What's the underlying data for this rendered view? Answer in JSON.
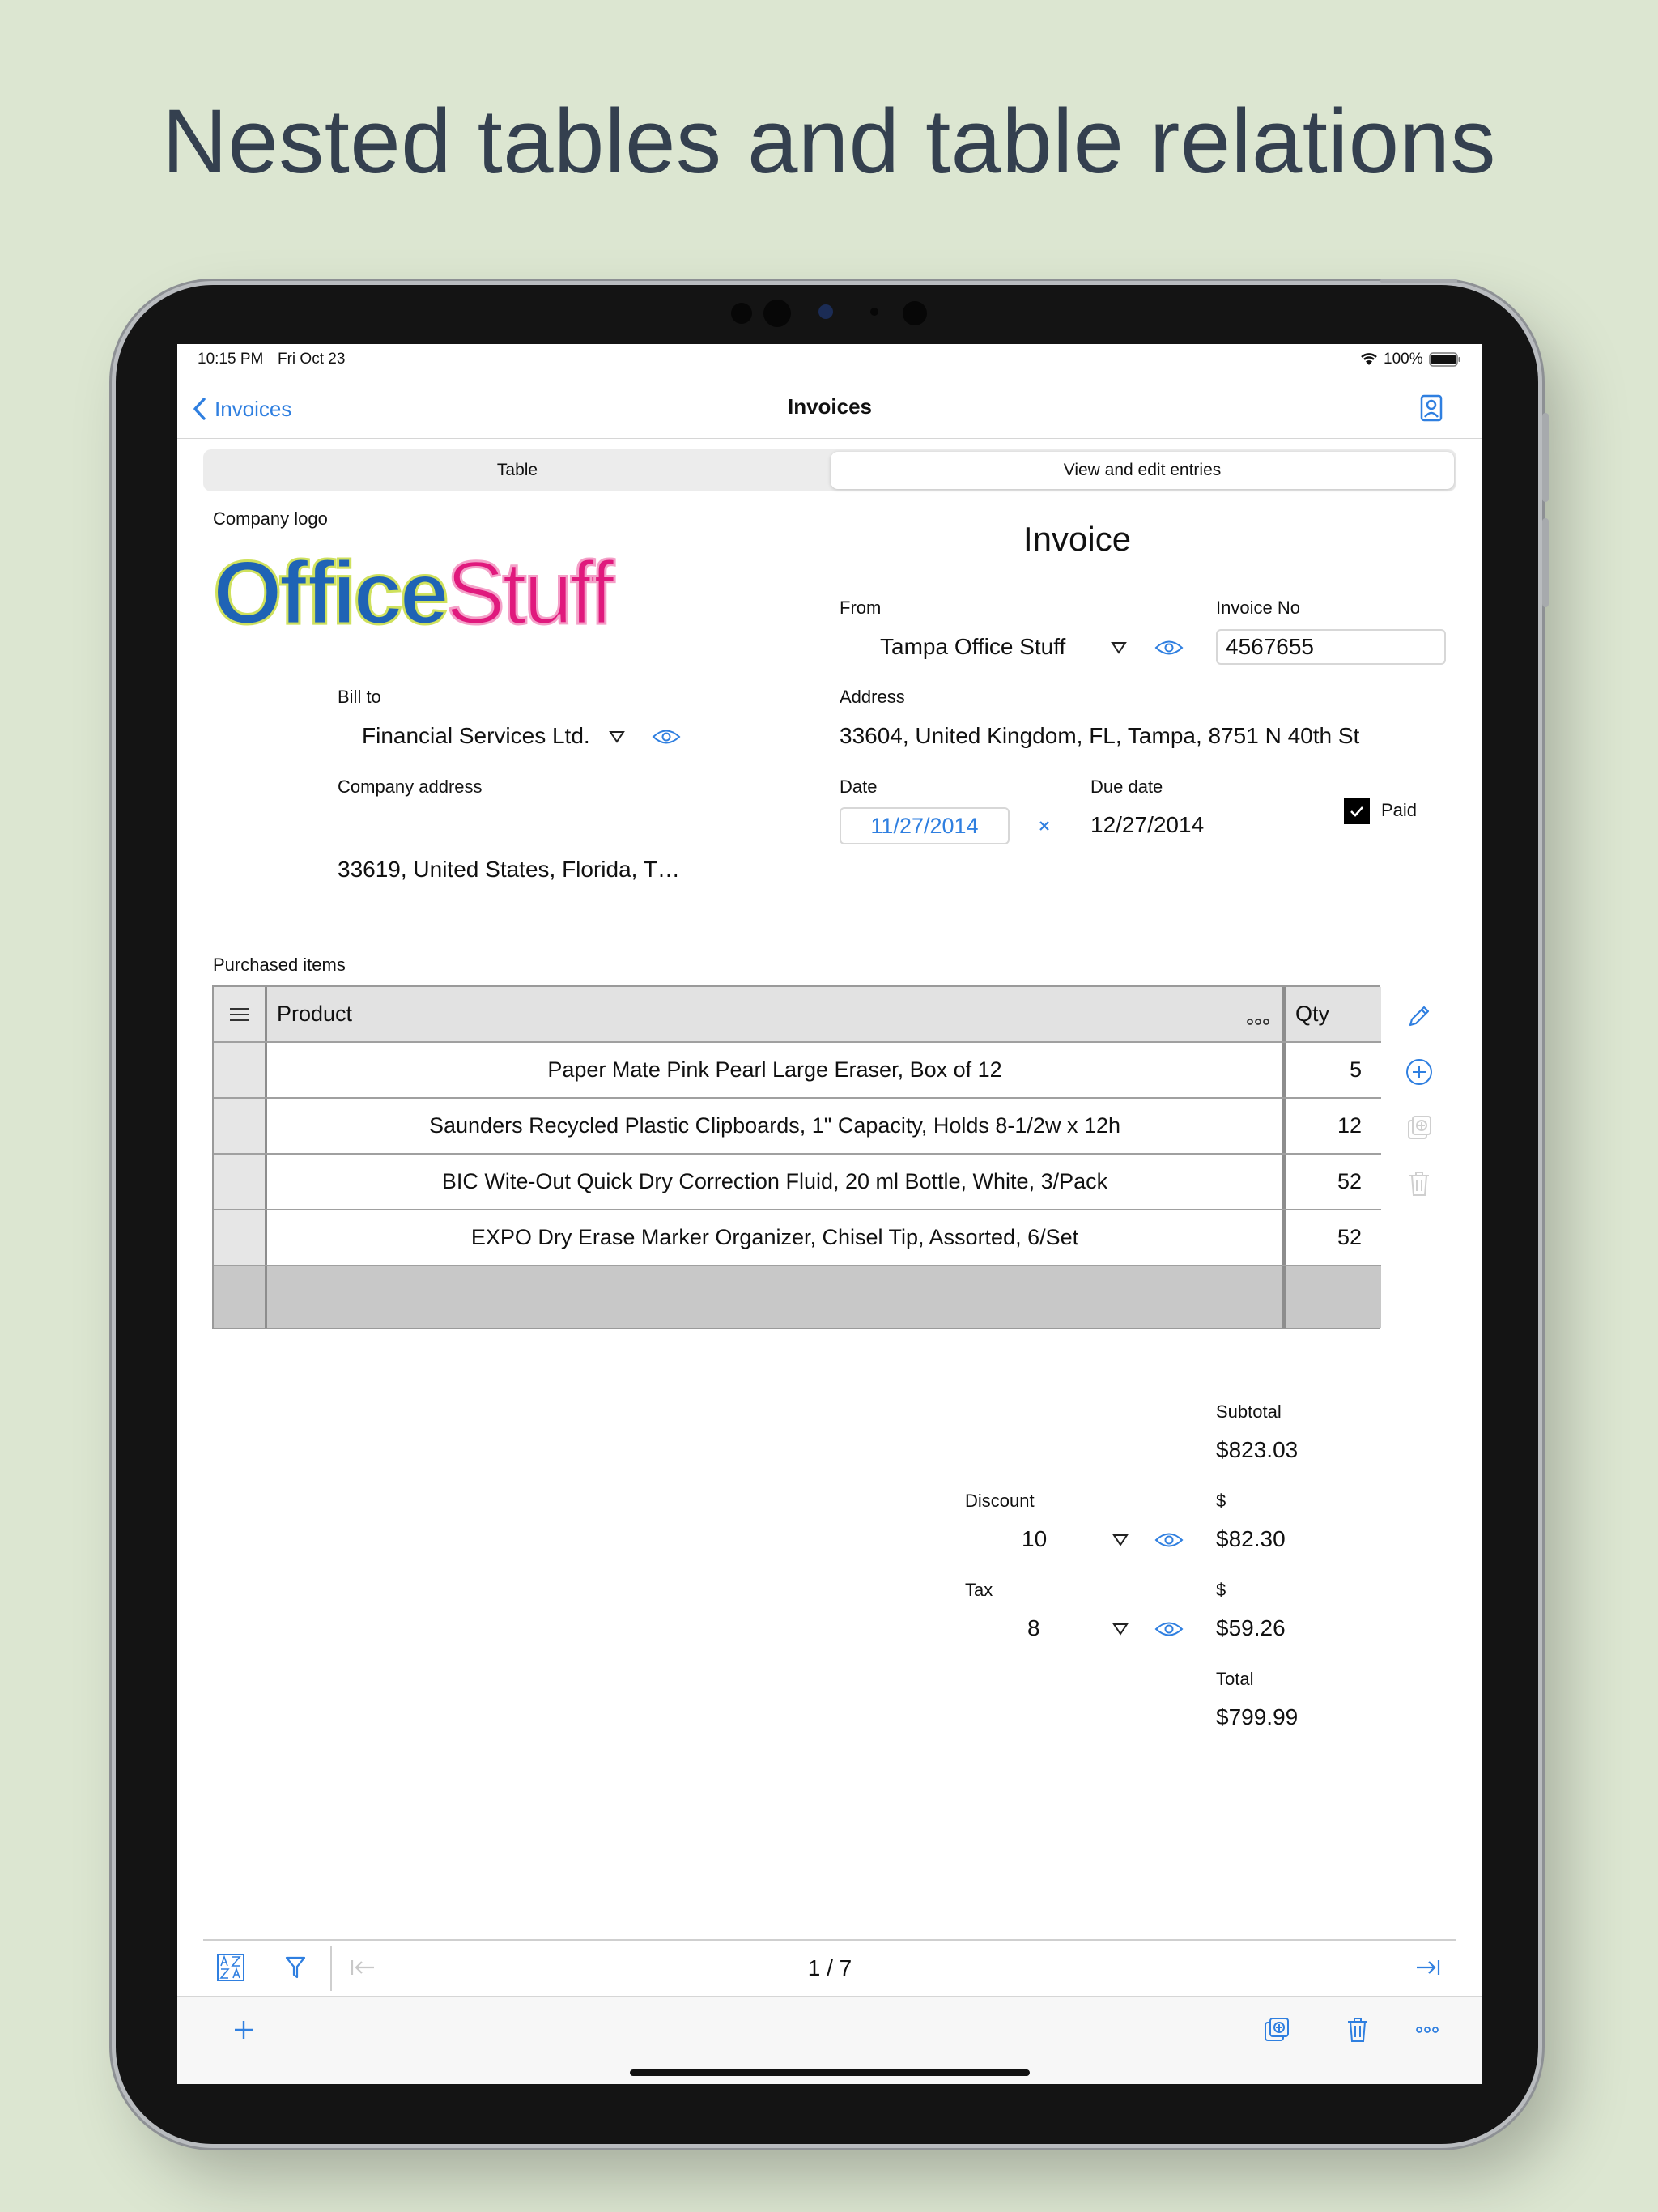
{
  "headline": "Nested tables and table relations",
  "status": {
    "time": "10:15 PM",
    "date": "Fri Oct 23",
    "battery": "100%"
  },
  "nav": {
    "back_label": "Invoices",
    "title": "Invoices",
    "right_icon": "person-card-icon"
  },
  "segments": {
    "table": "Table",
    "view_edit": "View and edit entries",
    "selected": "view_edit"
  },
  "form": {
    "company_logo_label": "Company logo",
    "logo": {
      "part1": "Office",
      "part2": "Stuff",
      "color1": "#1f63b5",
      "color2": "#e0197d"
    },
    "invoice_title": "Invoice",
    "from_label": "From",
    "from_value": "Tampa Office Stuff",
    "invoice_no_label": "Invoice No",
    "invoice_no_value": "4567655",
    "bill_to_label": "Bill to",
    "bill_to_value": "Financial Services Ltd.",
    "address_label": "Address",
    "address_value": "33604, United Kingdom, FL, Tampa, 8751 N 40th St",
    "company_address_label": "Company address",
    "company_address_value": "33619, United States, Florida, T…",
    "date_label": "Date",
    "date_value": "11/27/2014",
    "due_date_label": "Due date",
    "due_date_value": "12/27/2014",
    "paid_label": "Paid",
    "paid_checked": true
  },
  "items": {
    "label": "Purchased items",
    "columns": {
      "product": "Product",
      "qty": "Qty"
    },
    "rows": [
      {
        "product": "Paper Mate Pink Pearl Large Eraser, Box of 12",
        "qty": "5"
      },
      {
        "product": "Saunders Recycled Plastic Clipboards, 1\" Capacity, Holds 8-1/2w x 12h",
        "qty": "12"
      },
      {
        "product": "BIC Wite-Out Quick Dry Correction Fluid, 20 ml Bottle, White, 3/Pack",
        "qty": "52"
      },
      {
        "product": "EXPO Dry Erase Marker Organizer, Chisel Tip, Assorted, 6/Set",
        "qty": "52"
      }
    ]
  },
  "totals": {
    "subtotal_label": "Subtotal",
    "subtotal_value": "$823.03",
    "discount_label": "Discount",
    "discount_select": "10",
    "discount_currency": "$",
    "discount_value": "$82.30",
    "tax_label": "Tax",
    "tax_select": "8",
    "tax_currency": "$",
    "tax_value": "$59.26",
    "total_label": "Total",
    "total_value": "$799.99"
  },
  "pager": {
    "text": "1 / 7"
  },
  "colors": {
    "accent": "#2f7fe0",
    "background": "#dce6d1"
  }
}
